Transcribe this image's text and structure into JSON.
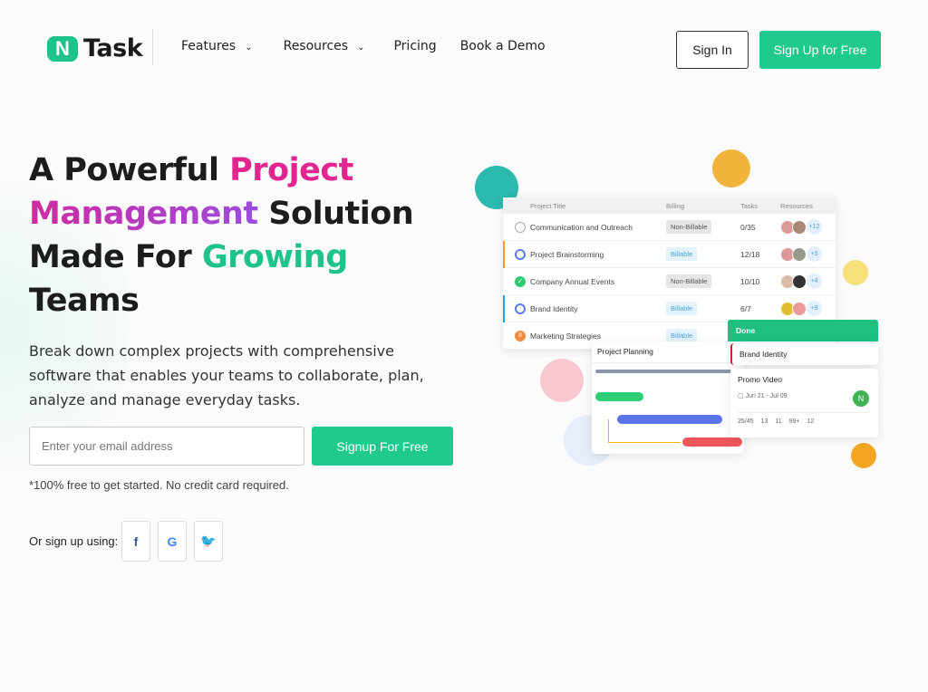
{
  "header": {
    "logo_text": "Task",
    "logo_mark": "N",
    "nav": [
      {
        "label": "Features",
        "dropdown": true
      },
      {
        "label": "Resources",
        "dropdown": true
      },
      {
        "label": "Pricing"
      },
      {
        "label": "Book a Demo"
      }
    ],
    "sign_in": "Sign In",
    "sign_up": "Sign Up for Free"
  },
  "hero": {
    "title_parts": [
      "A Powerful ",
      "Project",
      "Management",
      " Solution Made For ",
      "Growing",
      "Teams"
    ],
    "subtitle": "Break down complex projects with comprehensive software that enables your teams to collaborate, plan, analyze and manage everyday tasks.",
    "email_placeholder": "Enter your email address",
    "signup_button": "Signup For Free",
    "note": "*100% free to get started. No credit card required.",
    "or_sign_up": "Or sign up using:",
    "social": [
      "facebook",
      "google",
      "twitter"
    ]
  },
  "colors": {
    "brand": "#1fca8c",
    "pink": "#e2258f",
    "purple": "#9b4ddf"
  },
  "table": {
    "headers": [
      "Project Title",
      "Billing",
      "Tasks",
      "Resources"
    ],
    "rows": [
      {
        "title": "Communication and Outreach",
        "billing": "Non-Billable",
        "tasks": "0/35",
        "extra": "+12",
        "status": "open"
      },
      {
        "title": "Project Brainstorming",
        "billing": "Billable",
        "tasks": "12/18",
        "extra": "+5",
        "status": "in-progress"
      },
      {
        "title": "Company Annual Events",
        "billing": "Non-Billable",
        "tasks": "10/10",
        "extra": "+4",
        "status": "done"
      },
      {
        "title": "Brand Identity",
        "billing": "Billable",
        "tasks": "6/7",
        "extra": "+9",
        "status": "in-progress"
      },
      {
        "title": "Marketing Strategies",
        "billing": "Billable",
        "tasks": "",
        "extra": "",
        "status": "paused"
      }
    ]
  },
  "gantt": {
    "title": "Project Planning"
  },
  "kanban": {
    "column": "Done",
    "card1": "Brand Identity",
    "card2": {
      "title": "Promo Video",
      "dates": "Jun 21 - Jul 09",
      "avatar_letter": "N",
      "stats": [
        "25/45",
        "13",
        "11",
        "99+",
        "12"
      ]
    }
  }
}
